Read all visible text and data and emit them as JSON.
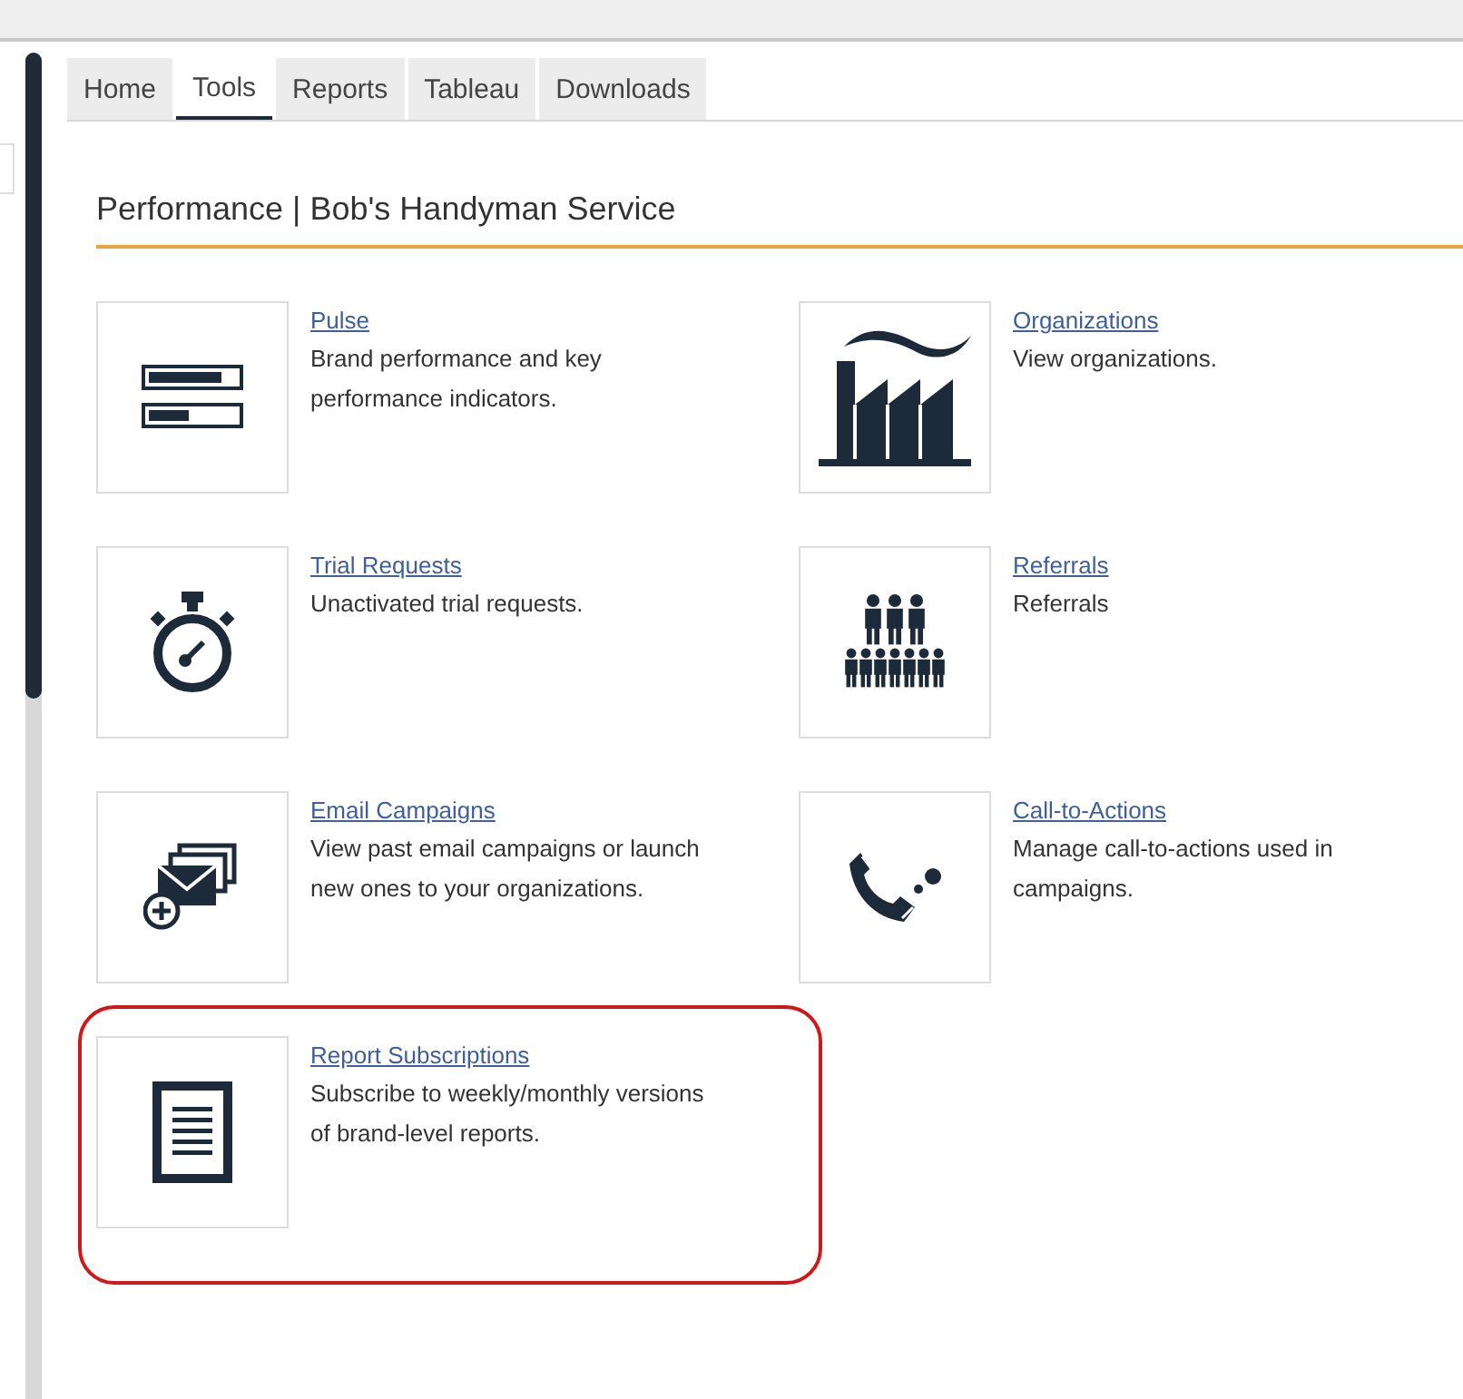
{
  "tabs": [
    {
      "label": "Home",
      "selected": false
    },
    {
      "label": "Tools",
      "selected": true
    },
    {
      "label": "Reports",
      "selected": false
    },
    {
      "label": "Tableau",
      "selected": false
    },
    {
      "label": "Downloads",
      "selected": false
    }
  ],
  "heading": "Performance | Bob's Handyman Service",
  "tools": [
    {
      "title": "Pulse",
      "description": "Brand performance and key performance indicators.",
      "highlighted": false
    },
    {
      "title": "Organizations",
      "description": "View organizations.",
      "highlighted": false
    },
    {
      "title": "Trial Requests",
      "description": "Unactivated trial requests.",
      "highlighted": false
    },
    {
      "title": "Referrals",
      "description": "Referrals",
      "highlighted": false
    },
    {
      "title": "Email Campaigns",
      "description": "View past email campaigns or launch new ones to your organizations.",
      "highlighted": false
    },
    {
      "title": "Call-to-Actions",
      "description": "Manage call-to-actions used in campaigns.",
      "highlighted": false
    },
    {
      "title": "Report Subscriptions",
      "description": "Subscribe to weekly/monthly versions of brand-level reports.",
      "highlighted": true
    }
  ]
}
